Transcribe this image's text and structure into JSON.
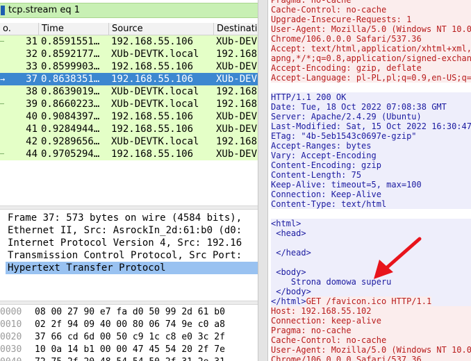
{
  "filter": {
    "value": "tcp.stream eq 1"
  },
  "packet_list": {
    "columns": [
      "o.",
      "Time",
      "Source",
      "Destination"
    ],
    "rows": [
      {
        "marker": "–",
        "no": "31",
        "time": "0.8591551…",
        "source": "192.168.55.106",
        "destination": "XUb-DEV",
        "selected": false
      },
      {
        "marker": "",
        "no": "32",
        "time": "0.8592177…",
        "source": "XUb-DEVTK.local",
        "destination": "192.168",
        "selected": false
      },
      {
        "marker": "",
        "no": "33",
        "time": "0.8599903…",
        "source": "192.168.55.106",
        "destination": "XUb-DEV",
        "selected": false
      },
      {
        "marker": "→",
        "no": "37",
        "time": "0.8638351…",
        "source": "192.168.55.106",
        "destination": "XUb-DEV",
        "selected": true
      },
      {
        "marker": "",
        "no": "38",
        "time": "0.8639019…",
        "source": "XUb-DEVTK.local",
        "destination": "192.168",
        "selected": false
      },
      {
        "marker": "–",
        "no": "39",
        "time": "0.8660223…",
        "source": "XUb-DEVTK.local",
        "destination": "192.168",
        "selected": false
      },
      {
        "marker": "",
        "no": "40",
        "time": "0.9084397…",
        "source": "192.168.55.106",
        "destination": "XUb-DEV",
        "selected": false
      },
      {
        "marker": "",
        "no": "41",
        "time": "0.9284944…",
        "source": "192.168.55.106",
        "destination": "XUb-DEV",
        "selected": false
      },
      {
        "marker": "",
        "no": "42",
        "time": "0.9289656…",
        "source": "XUb-DEVTK.local",
        "destination": "192.168",
        "selected": false
      },
      {
        "marker": "–",
        "no": "44",
        "time": "0.9705294…",
        "source": "192.168.55.106",
        "destination": "XUb-DEV",
        "selected": false
      }
    ]
  },
  "details": {
    "lines": [
      {
        "text": "Frame 37: 573 bytes on wire (4584 bits),",
        "selected": false
      },
      {
        "text": "Ethernet II, Src: AsrockIn_2d:61:b0 (d0:",
        "selected": false
      },
      {
        "text": "Internet Protocol Version 4, Src: 192.16",
        "selected": false
      },
      {
        "text": "Transmission Control Protocol, Src Port:",
        "selected": false
      },
      {
        "text": "Hypertext Transfer Protocol",
        "selected": true
      }
    ]
  },
  "bytes": {
    "rows": [
      {
        "offset": "0000",
        "hex": "08 00 27 90 e7 fa d0 50  99 2d 61 b0"
      },
      {
        "offset": "0010",
        "hex": "02 2f 94 09 40 00 80 06  74 9e c0 a8"
      },
      {
        "offset": "0020",
        "hex": "37 66 cd 6d 00 50 c9 1c  c8 e0 3c 2f"
      },
      {
        "offset": "0030",
        "hex": "10 0a 14 b1 00 00 47 45  54 20 2f 7e"
      },
      {
        "offset": "0040",
        "hex": "72 75 2f 20 48 54 54 50  2f 31 2e 31"
      }
    ]
  },
  "stream": {
    "lines": [
      {
        "text": "Pragma: no-cache",
        "kind": "client"
      },
      {
        "text": "Cache-Control: no-cache",
        "kind": "client"
      },
      {
        "text": "Upgrade-Insecure-Requests: 1",
        "kind": "client"
      },
      {
        "text": "User-Agent: Mozilla/5.0 (Windows NT 10.0",
        "kind": "client"
      },
      {
        "text": "Chrome/106.0.0.0 Safari/537.36",
        "kind": "client"
      },
      {
        "text": "Accept: text/html,application/xhtml+xml,",
        "kind": "client"
      },
      {
        "text": "apng,*/*;q=0.8,application/signed-exchan",
        "kind": "client"
      },
      {
        "text": "Accept-Encoding: gzip, deflate",
        "kind": "client"
      },
      {
        "text": "Accept-Language: pl-PL,pl;q=0.9,en-US;q=",
        "kind": "client"
      },
      {
        "text": "",
        "kind": "blank"
      },
      {
        "text": "HTTP/1.1 200 OK",
        "kind": "server"
      },
      {
        "text": "Date: Tue, 18 Oct 2022 07:08:38 GMT",
        "kind": "server"
      },
      {
        "text": "Server: Apache/2.4.29 (Ubuntu)",
        "kind": "server"
      },
      {
        "text": "Last-Modified: Sat, 15 Oct 2022 16:30:47",
        "kind": "server"
      },
      {
        "text": "ETag: \"4b-5eb1543c0697e-gzip\"",
        "kind": "server"
      },
      {
        "text": "Accept-Ranges: bytes",
        "kind": "server"
      },
      {
        "text": "Vary: Accept-Encoding",
        "kind": "server"
      },
      {
        "text": "Content-Encoding: gzip",
        "kind": "server"
      },
      {
        "text": "Content-Length: 75",
        "kind": "server"
      },
      {
        "text": "Keep-Alive: timeout=5, max=100",
        "kind": "server"
      },
      {
        "text": "Connection: Keep-Alive",
        "kind": "server"
      },
      {
        "text": "Content-Type: text/html",
        "kind": "server"
      },
      {
        "text": "",
        "kind": "blank"
      },
      {
        "text": "<html>",
        "kind": "server"
      },
      {
        "text": " <head>",
        "kind": "server"
      },
      {
        "text": "",
        "kind": "server"
      },
      {
        "text": " </head>",
        "kind": "server"
      },
      {
        "text": "",
        "kind": "server"
      },
      {
        "text": " <body>",
        "kind": "server"
      },
      {
        "text": "    Strona domowa superu",
        "kind": "server"
      },
      {
        "text": " </body>",
        "kind": "server"
      },
      {
        "text": "</html>GET /favicon.ico HTTP/1.1",
        "kind": "mixed"
      },
      {
        "text": "Host: 192.168.55.102",
        "kind": "client"
      },
      {
        "text": "Connection: keep-alive",
        "kind": "client"
      },
      {
        "text": "Pragma: no-cache",
        "kind": "client"
      },
      {
        "text": "Cache-Control: no-cache",
        "kind": "client"
      },
      {
        "text": "User-Agent: Mozilla/5.0 (Windows NT 10.0",
        "kind": "client"
      },
      {
        "text": "Chrome/106.0.0.0 Safari/537.36",
        "kind": "client"
      }
    ]
  },
  "colors": {
    "accent_arrow": "#e8141b",
    "row_green": "#e4ffc7",
    "row_selected": "#3c87d0",
    "client_text": "#b81c1c",
    "server_text": "#1a1aa0"
  }
}
